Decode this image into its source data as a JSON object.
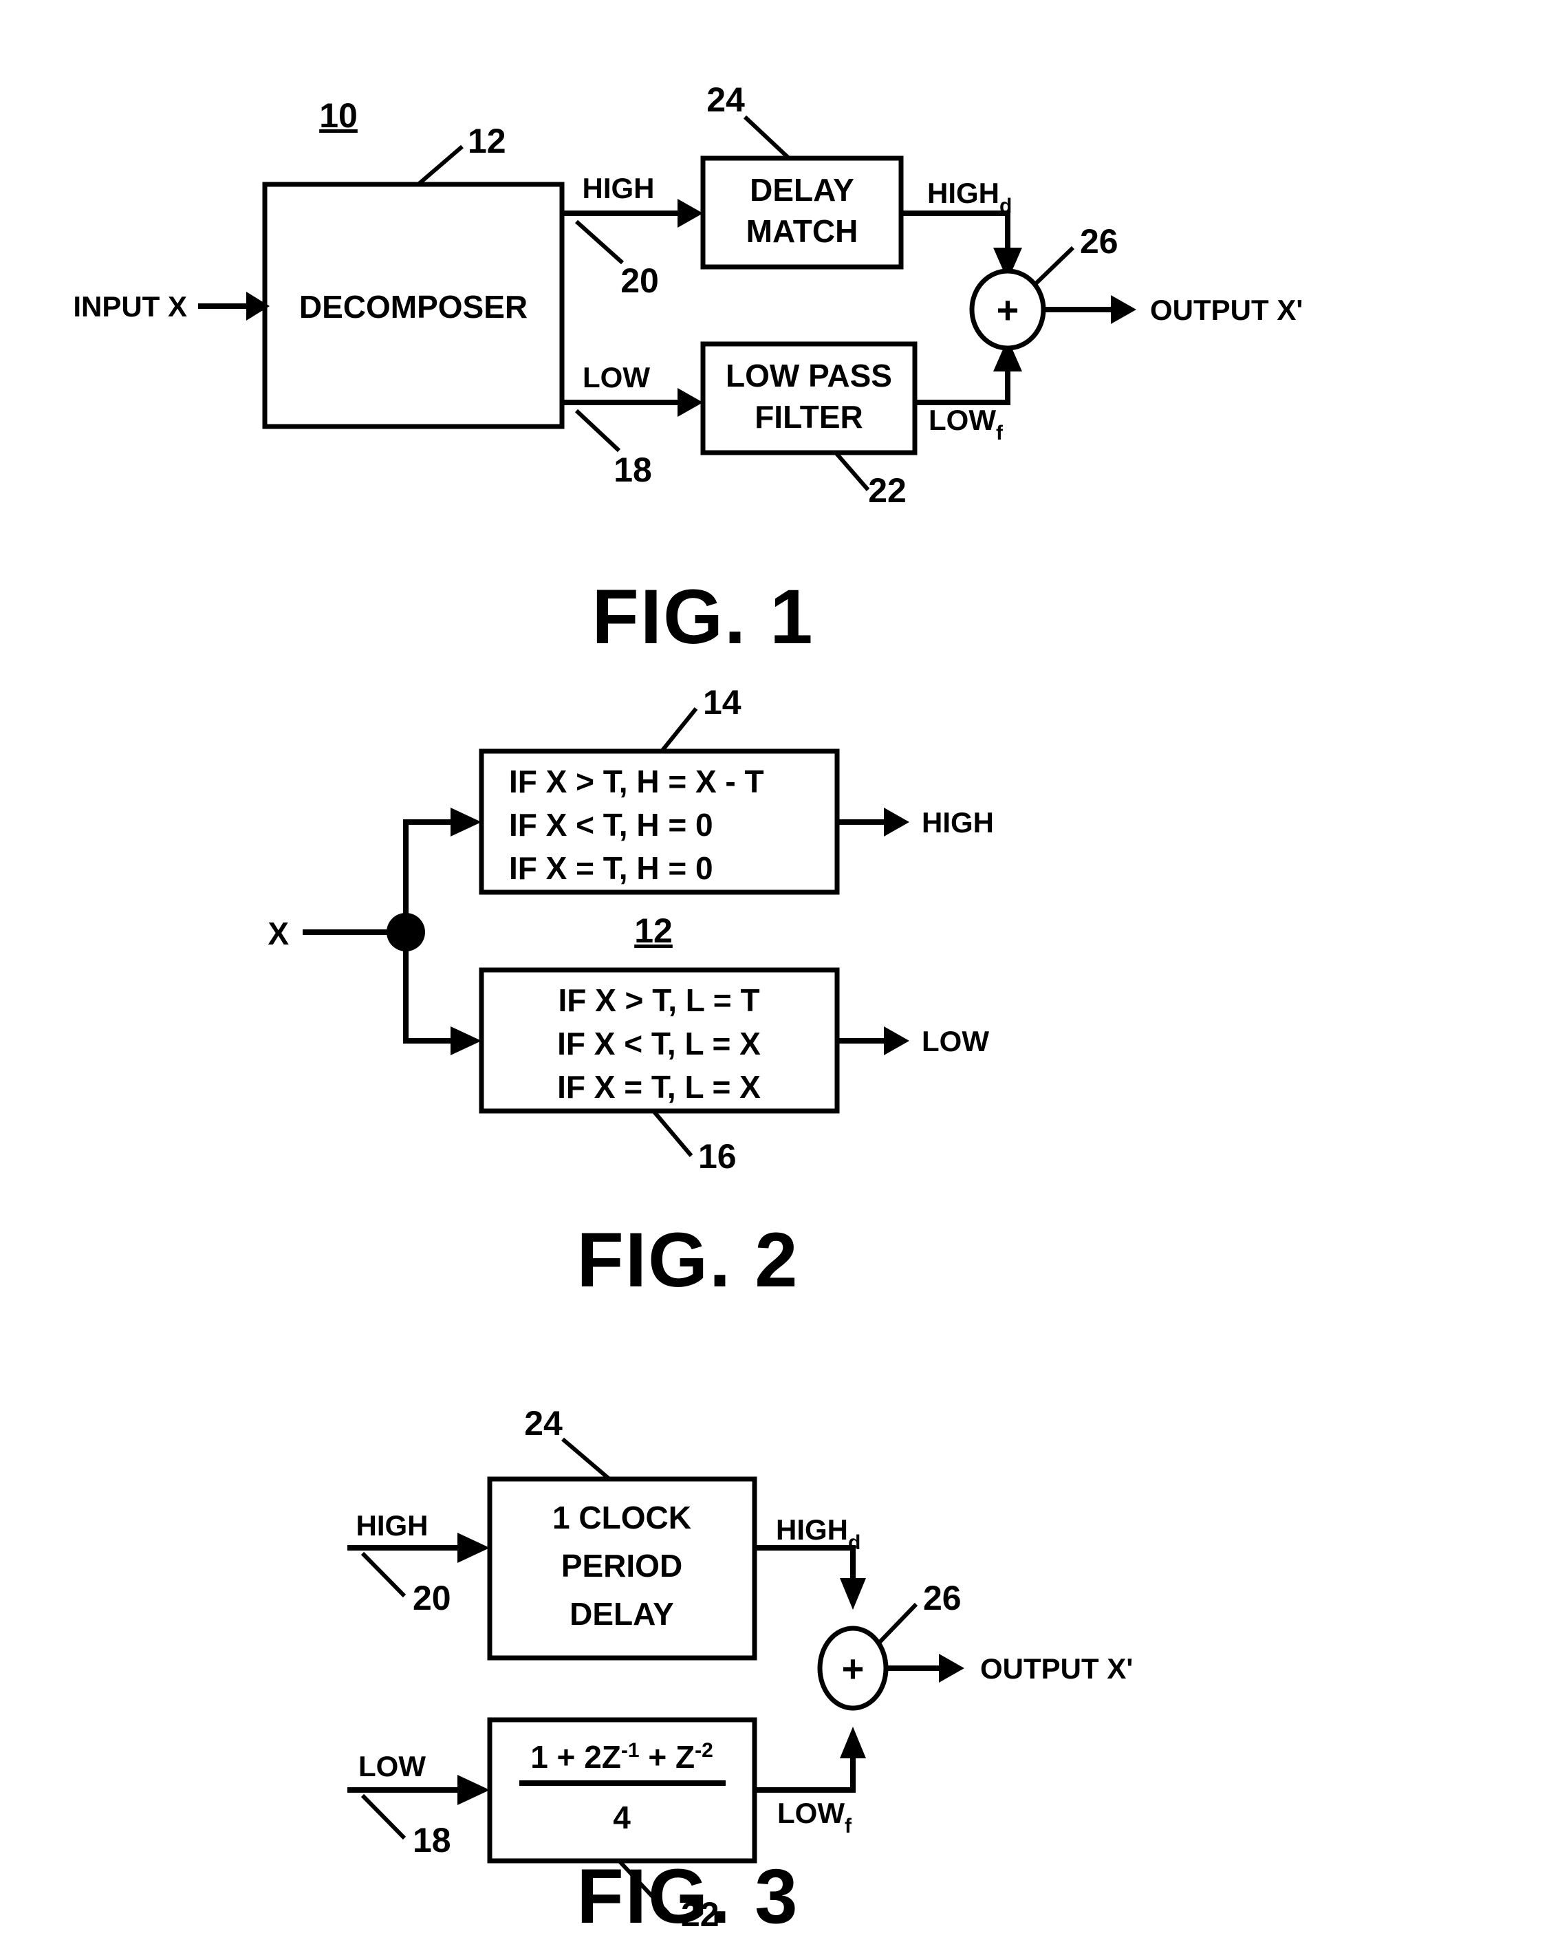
{
  "document": {
    "type": "patent-drawing-sheet",
    "figure_count": 3
  },
  "figure1": {
    "caption": "FIG. 1",
    "system_ref": "10",
    "input_label": "INPUT X",
    "decomposer": {
      "label": "DECOMPOSER",
      "ref": "12"
    },
    "high_signal": {
      "label": "HIGH",
      "ref": "20"
    },
    "low_signal": {
      "label": "LOW",
      "ref": "18"
    },
    "delay_match": {
      "line1": "DELAY",
      "line2": "MATCH",
      "ref": "24"
    },
    "low_pass_filter": {
      "line1": "LOW PASS",
      "line2": "FILTER",
      "ref": "22"
    },
    "high_delayed": {
      "base": "HIGH",
      "sub": "d"
    },
    "low_filtered": {
      "base": "LOW",
      "sub": "f"
    },
    "summer": {
      "symbol": "+",
      "ref": "26"
    },
    "output_label": "OUTPUT X'"
  },
  "figure2": {
    "caption": "FIG. 2",
    "input_label": "X",
    "decomposer_ref": "12",
    "high_block": {
      "ref": "14",
      "lines": [
        "IF X > T, H = X - T",
        "IF X < T, H = 0",
        "IF X = T, H = 0"
      ],
      "output_label": "HIGH"
    },
    "low_block": {
      "ref": "16",
      "lines": [
        "IF X > T, L = T",
        "IF X < T, L = X",
        "IF X = T, L = X"
      ],
      "output_label": "LOW"
    }
  },
  "figure3": {
    "caption": "FIG. 3",
    "high_signal": {
      "label": "HIGH",
      "ref": "20"
    },
    "low_signal": {
      "label": "LOW",
      "ref": "18"
    },
    "delay_block": {
      "line1": "1 CLOCK",
      "line2": "PERIOD",
      "line3": "DELAY",
      "ref": "24"
    },
    "filter_block": {
      "ref": "22",
      "numerator": {
        "p1": "1 + 2Z",
        "e1": "-1",
        "p2": " + Z",
        "e2": "-2"
      },
      "denominator": "4"
    },
    "high_delayed": {
      "base": "HIGH",
      "sub": "d"
    },
    "low_filtered": {
      "base": "LOW",
      "sub": "f"
    },
    "summer": {
      "symbol": "+",
      "ref": "26"
    },
    "output_label": "OUTPUT X'"
  },
  "colors": {
    "ink": "#000000",
    "paper": "#ffffff"
  }
}
